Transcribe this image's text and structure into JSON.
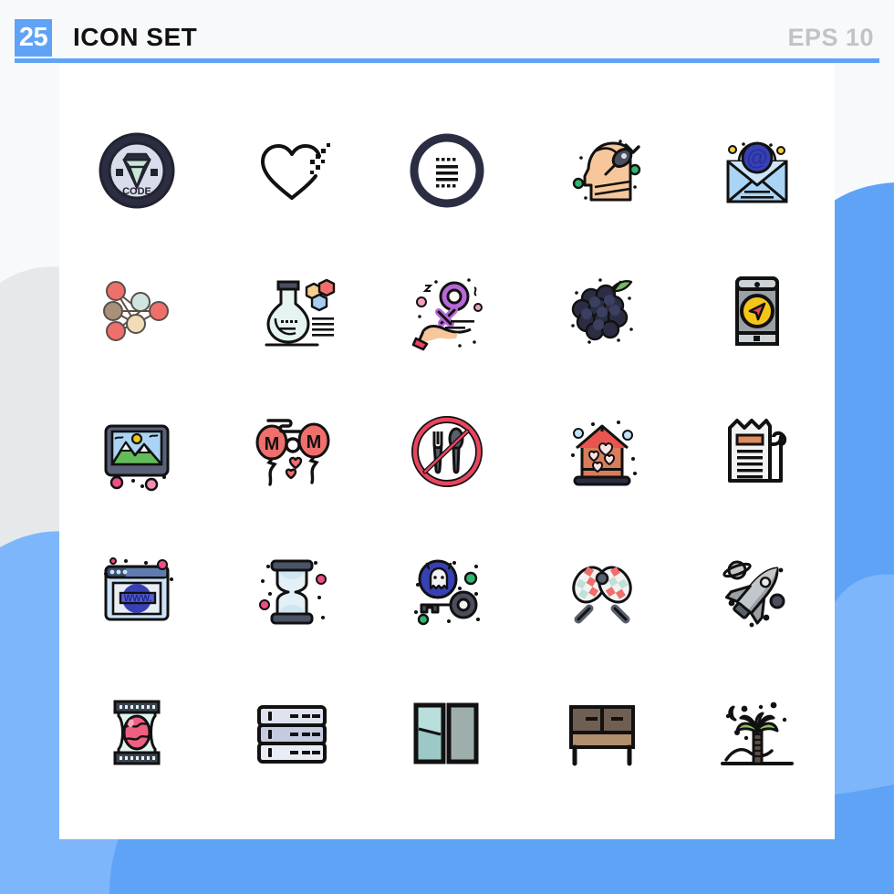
{
  "header": {
    "count_badge": "25",
    "title": "ICON SET",
    "format_label": "EPS 10",
    "accent_color": "#5fa3f7",
    "title_color": "#111111",
    "format_color": "#bfc4c9"
  },
  "canvas": {
    "background_color": "#f7f9fb",
    "sheet_color": "#ffffff",
    "decor_blue_light": "#7db6fa",
    "decor_blue_mid": "#5fa3f7",
    "decor_gray": "#e5e9ec"
  },
  "grid": {
    "columns": 5,
    "rows": 5,
    "total_icons": 25
  },
  "icons": [
    {
      "index": 1,
      "name": "code-diamond-badge-icon",
      "label": "Code Diamond Badge",
      "row": 1,
      "col": 1,
      "text": "CODE"
    },
    {
      "index": 2,
      "name": "pixel-heart-icon",
      "label": "Pixel Heart",
      "row": 1,
      "col": 2,
      "text": ""
    },
    {
      "index": 3,
      "name": "list-circle-icon",
      "label": "List In Circle",
      "row": 1,
      "col": 3,
      "text": ""
    },
    {
      "index": 4,
      "name": "head-plug-icon",
      "label": "Head With Plug",
      "row": 1,
      "col": 4,
      "text": ""
    },
    {
      "index": 5,
      "name": "email-at-envelope-icon",
      "label": "Email At Envelope",
      "row": 1,
      "col": 5,
      "text": "@"
    },
    {
      "index": 6,
      "name": "neural-network-icon",
      "label": "Neural Network",
      "row": 2,
      "col": 1,
      "text": ""
    },
    {
      "index": 7,
      "name": "chemistry-flask-icon",
      "label": "Chemistry Flask",
      "row": 2,
      "col": 2,
      "text": ""
    },
    {
      "index": 8,
      "name": "hand-female-symbol-icon",
      "label": "Hand Female Symbol",
      "row": 2,
      "col": 3,
      "text": ""
    },
    {
      "index": 9,
      "name": "blackberry-icon",
      "label": "Blackberry",
      "row": 2,
      "col": 4,
      "text": ""
    },
    {
      "index": 10,
      "name": "mobile-navigation-icon",
      "label": "Mobile Navigation",
      "row": 2,
      "col": 5,
      "text": ""
    },
    {
      "index": 11,
      "name": "landscape-photo-icon",
      "label": "Landscape Photo",
      "row": 3,
      "col": 1,
      "text": ""
    },
    {
      "index": 12,
      "name": "mom-balloons-icon",
      "label": "Mom Balloons",
      "row": 3,
      "col": 2,
      "text": "MOM"
    },
    {
      "index": 13,
      "name": "no-food-icon",
      "label": "No Food",
      "row": 3,
      "col": 3,
      "text": ""
    },
    {
      "index": 14,
      "name": "love-house-icon",
      "label": "Love House",
      "row": 3,
      "col": 4,
      "text": ""
    },
    {
      "index": 15,
      "name": "receipt-bill-icon",
      "label": "Receipt Bill",
      "row": 3,
      "col": 5,
      "text": ""
    },
    {
      "index": 16,
      "name": "www-browser-icon",
      "label": "WWW Browser",
      "row": 4,
      "col": 1,
      "text": "WWW."
    },
    {
      "index": 17,
      "name": "hourglass-icon",
      "label": "Hourglass",
      "row": 4,
      "col": 2,
      "text": ""
    },
    {
      "index": 18,
      "name": "ghost-key-icon",
      "label": "Ghost Key",
      "row": 4,
      "col": 3,
      "text": ""
    },
    {
      "index": 19,
      "name": "maracas-icon",
      "label": "Maracas",
      "row": 4,
      "col": 4,
      "text": ""
    },
    {
      "index": 20,
      "name": "space-shuttle-icon",
      "label": "Space Shuttle",
      "row": 4,
      "col": 5,
      "text": ""
    },
    {
      "index": 21,
      "name": "egg-package-icon",
      "label": "Egg Package",
      "row": 5,
      "col": 1,
      "text": ""
    },
    {
      "index": 22,
      "name": "server-rack-icon",
      "label": "Server Rack",
      "row": 5,
      "col": 2,
      "text": ""
    },
    {
      "index": 23,
      "name": "mirror-panels-icon",
      "label": "Mirror Panels",
      "row": 5,
      "col": 3,
      "text": ""
    },
    {
      "index": 24,
      "name": "console-table-icon",
      "label": "Console Table",
      "row": 5,
      "col": 4,
      "text": ""
    },
    {
      "index": 25,
      "name": "palm-tree-night-icon",
      "label": "Palm Tree Night",
      "row": 5,
      "col": 5,
      "text": ""
    }
  ]
}
